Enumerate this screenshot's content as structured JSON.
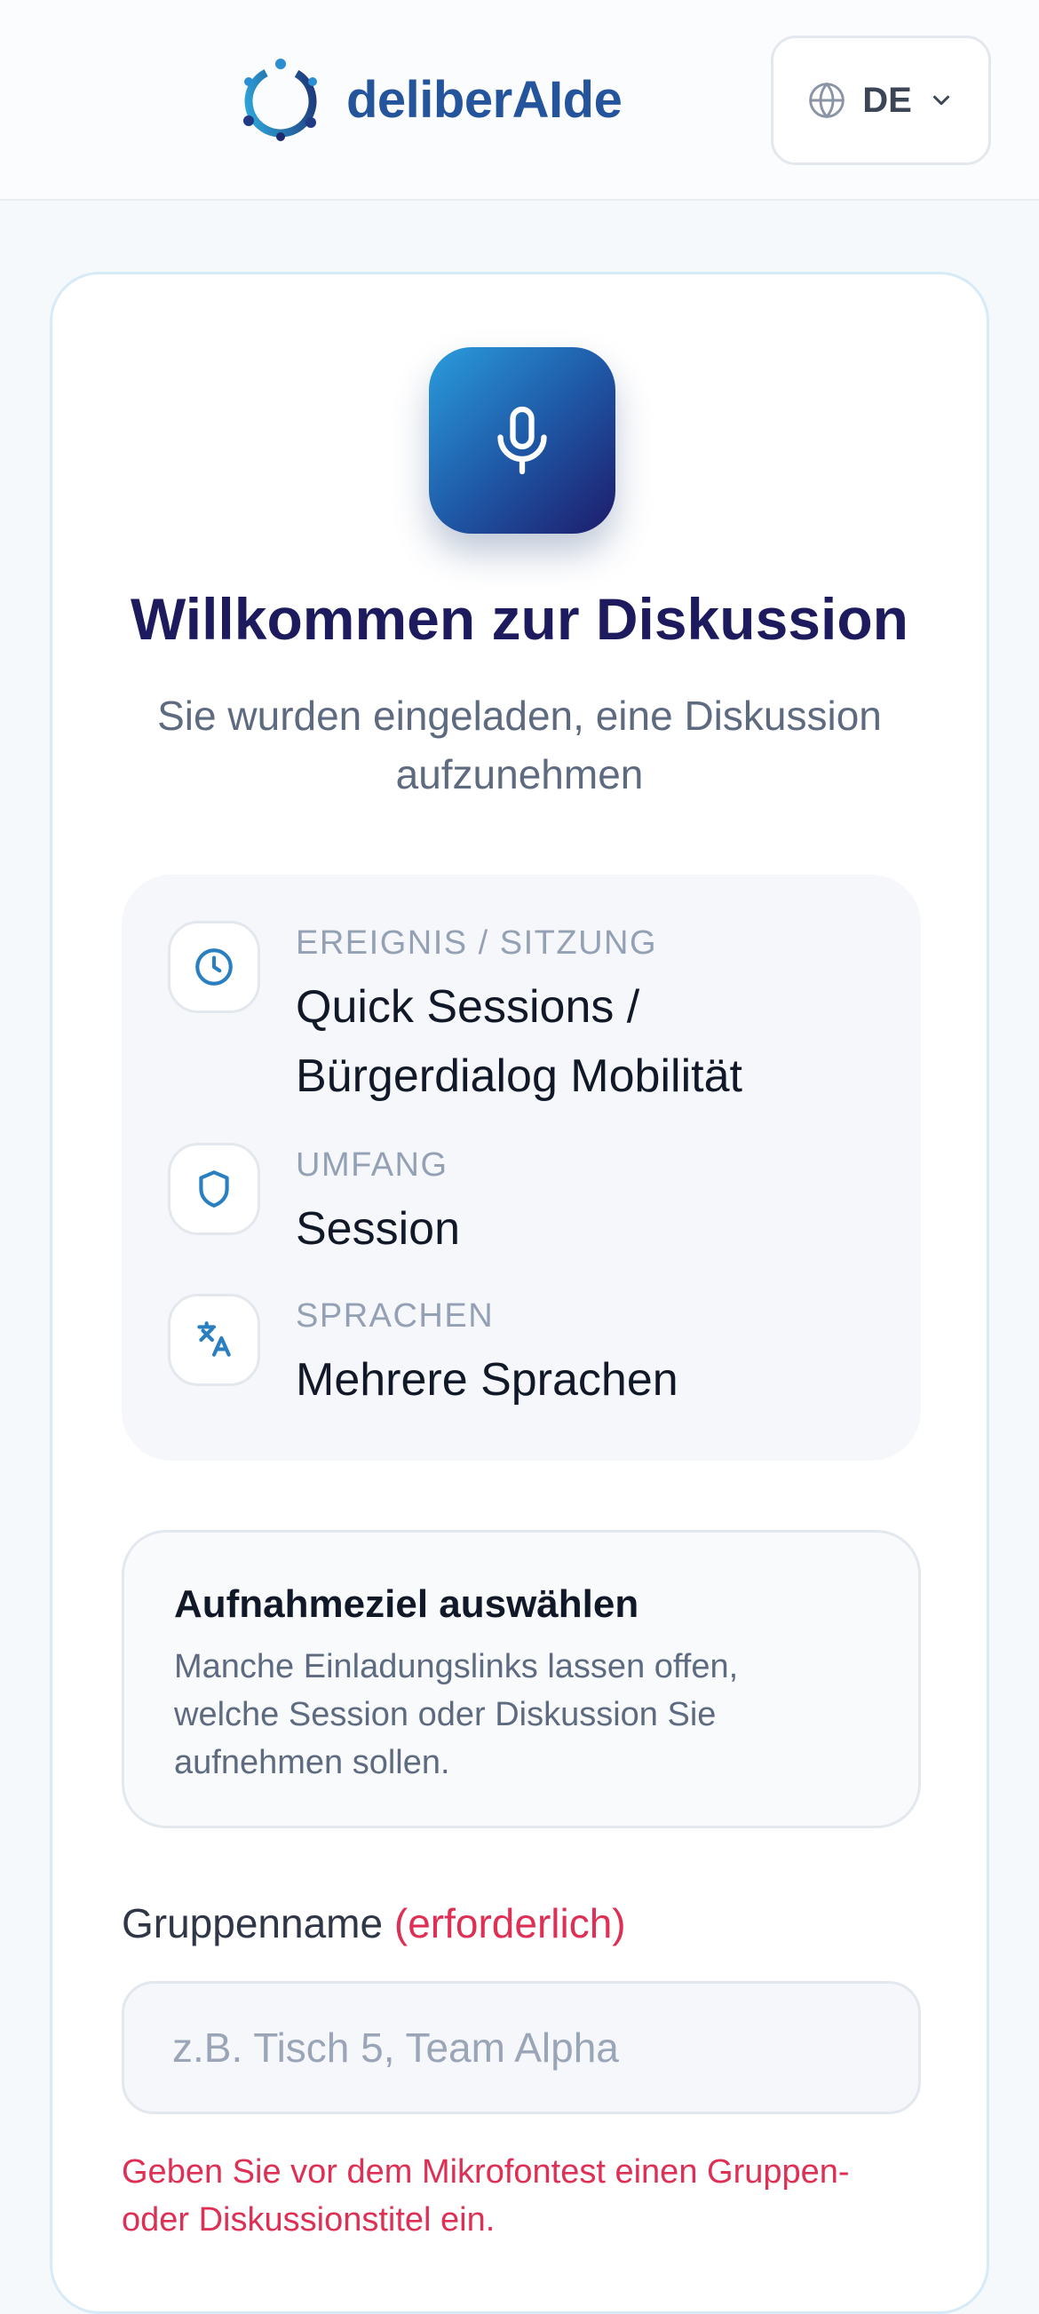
{
  "header": {
    "brand": "deliberAIde",
    "language_code": "DE"
  },
  "hero": {
    "title": "Willkommen zur Diskussion",
    "subtitle": "Sie wurden eingeladen, eine Diskussion aufzunehmen"
  },
  "info": {
    "items": [
      {
        "icon": "clock-icon",
        "label": "EREIGNIS / SITZUNG",
        "value": "Quick Sessions / Bürgerdialog Mobilität"
      },
      {
        "icon": "shield-icon",
        "label": "UMFANG",
        "value": "Session"
      },
      {
        "icon": "translate-icon",
        "label": "SPRACHEN",
        "value": "Mehrere Sprachen"
      }
    ]
  },
  "target": {
    "title": "Aufnahmeziel auswählen",
    "description": "Manche Einladungslinks lassen offen, welche Session oder Diskussion Sie aufnehmen sollen."
  },
  "group_field": {
    "label": "Gruppenname",
    "required_label": "(erforderlich)",
    "value": "",
    "placeholder": "z.B. Tisch 5, Team Alpha",
    "error": "Geben Sie vor dem Mikrofontest einen Gruppen- oder Diskussionstitel ein."
  },
  "colors": {
    "brand": "#24549c",
    "title": "#1d1b5e",
    "error": "#de2f55",
    "accent": "#2a7fc0"
  }
}
